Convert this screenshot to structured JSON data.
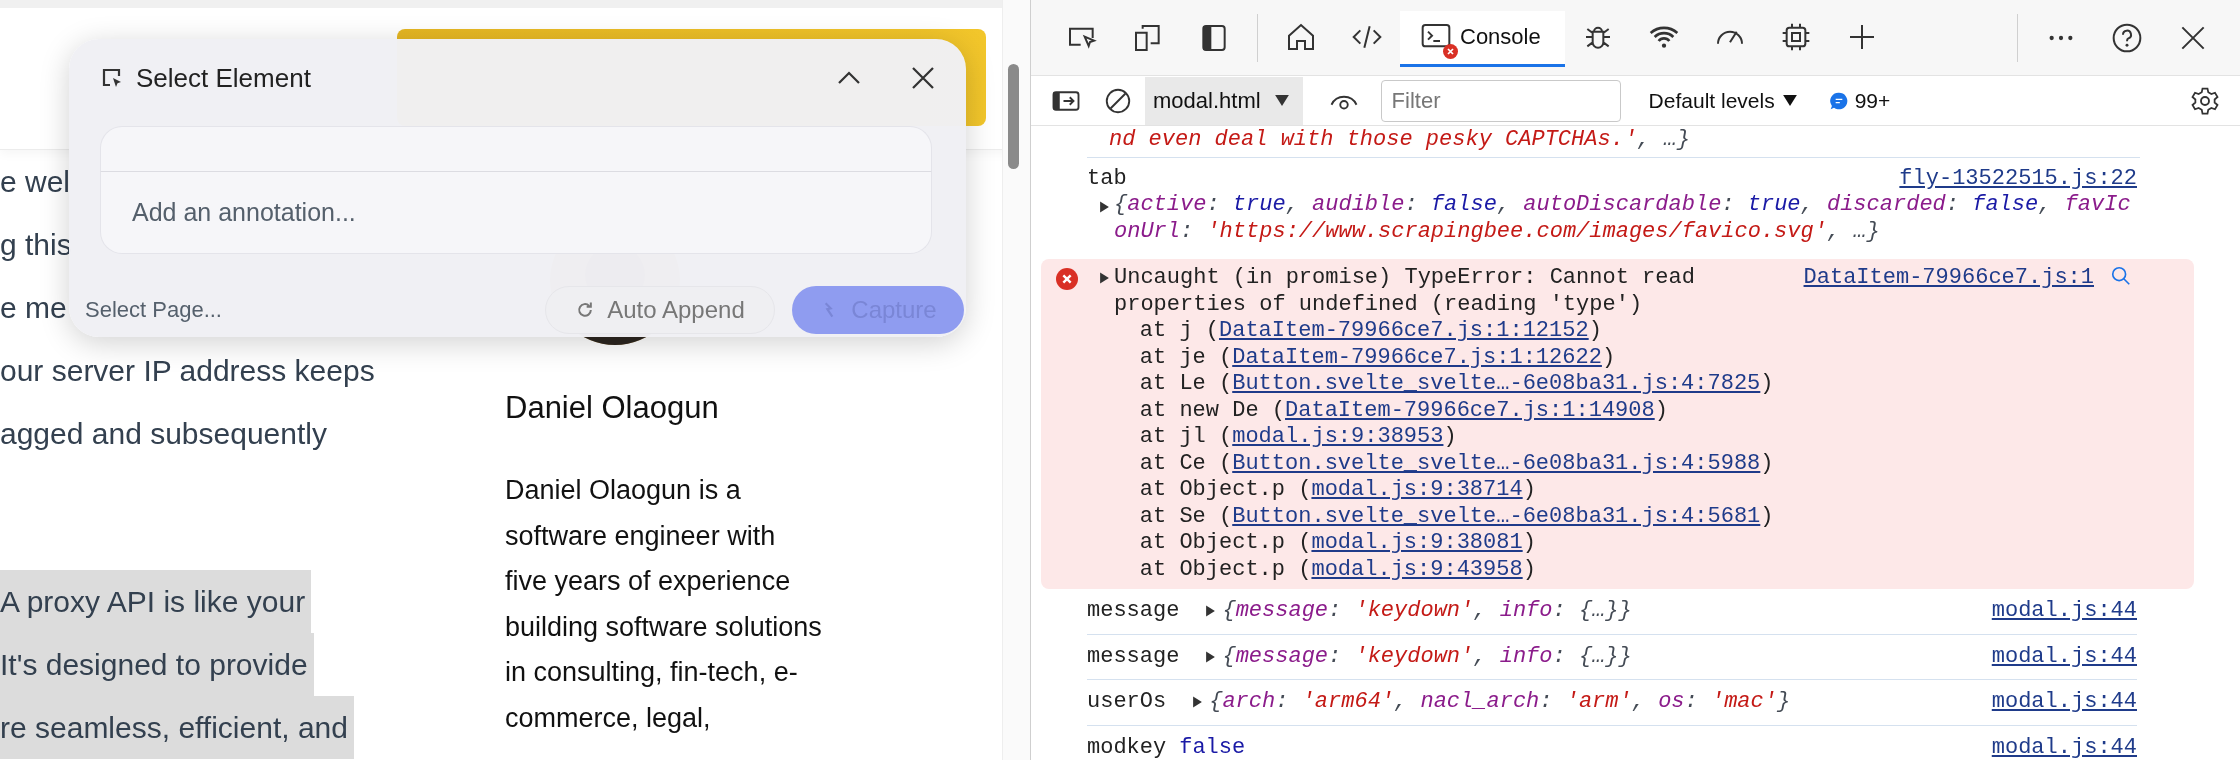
{
  "page": {
    "article_paragraphs": [
      {
        "highlighted": false,
        "lines": [
          "e wel",
          "g this",
          "e me",
          "our server IP address keeps",
          "agged and subsequently"
        ]
      },
      {
        "highlighted": true,
        "lines": [
          "A proxy API is like your",
          "It's designed to provide",
          "re seamless, efficient, and"
        ]
      }
    ],
    "author": {
      "name": "Daniel Olaogun",
      "bio_lines": [
        "Daniel Olaogun is a",
        "software engineer with",
        "five years of experience",
        "building software solutions",
        "in consulting, fin-tech, e-",
        "commerce, legal,"
      ]
    }
  },
  "select_panel": {
    "title": "Select Element",
    "annotation": {
      "placeholder": "Add an annotation..."
    },
    "page_select": {
      "placeholder": "Select Page..."
    },
    "auto_append": {
      "label": "Auto Append"
    },
    "capture": {
      "label": "Capture",
      "disabled": true
    }
  },
  "devtools": {
    "left_buttons": [
      {
        "kind": "inspect"
      },
      {
        "kind": "device"
      },
      {
        "kind": "sidebar"
      }
    ],
    "tabs": [
      {
        "kind": "home",
        "selected": false,
        "error_badge": false
      },
      {
        "kind": "code",
        "selected": false,
        "error_badge": false
      },
      {
        "kind": "console",
        "label": "Console",
        "selected": true,
        "error_badge": true
      },
      {
        "kind": "bug",
        "selected": false,
        "error_badge": false
      },
      {
        "kind": "wifi",
        "selected": false,
        "error_badge": false
      },
      {
        "kind": "gauge",
        "selected": false,
        "error_badge": false
      },
      {
        "kind": "chip",
        "selected": false,
        "error_badge": false
      },
      {
        "kind": "plus",
        "selected": false,
        "error_badge": false
      }
    ],
    "right_buttons": [
      {
        "kind": "more"
      },
      {
        "kind": "help"
      },
      {
        "kind": "close"
      }
    ],
    "console_toolbar": {
      "context": "modal.html",
      "filter": {
        "placeholder": "Filter"
      },
      "levels": "Default levels",
      "message_count": "99+"
    },
    "entries": [
      {
        "kind": "continuation",
        "tokens": [
          {
            "kind": "str",
            "text": "nd even deal with those pesky CAPTCHAs.'"
          },
          {
            "kind": "punct",
            "text": ", …}"
          }
        ]
      },
      {
        "kind": "log",
        "label": "tab",
        "source": "fly-13522515.js:22",
        "expandable": true,
        "wrapped": true,
        "tokens": [
          {
            "kind": "punct",
            "text": "{"
          },
          {
            "kind": "key",
            "text": "active"
          },
          {
            "kind": "punct",
            "text": ": "
          },
          {
            "kind": "lit",
            "text": "true"
          },
          {
            "kind": "punct",
            "text": ", "
          },
          {
            "kind": "key",
            "text": "audible"
          },
          {
            "kind": "punct",
            "text": ": "
          },
          {
            "kind": "lit",
            "text": "false"
          },
          {
            "kind": "punct",
            "text": ", "
          },
          {
            "kind": "key",
            "text": "autoDiscardable"
          },
          {
            "kind": "punct",
            "text": ": "
          },
          {
            "kind": "lit",
            "text": "true"
          },
          {
            "kind": "punct",
            "text": ", "
          },
          {
            "kind": "key",
            "text": "discarded"
          },
          {
            "kind": "punct",
            "text": ": "
          },
          {
            "kind": "lit",
            "text": "false"
          },
          {
            "kind": "punct",
            "text": ", "
          },
          {
            "kind": "key",
            "text": "favIconUrl"
          },
          {
            "kind": "punct",
            "text": ": "
          },
          {
            "kind": "str",
            "text": "'https://www.scrapingbee.com/images/favico.svg'"
          },
          {
            "kind": "punct",
            "text": ", …}"
          }
        ]
      },
      {
        "kind": "error",
        "message": "Uncaught (in promise) TypeError: Cannot read properties of undefined (reading 'type')",
        "source": "DataItem-79966ce7.js:1",
        "stack": [
          {
            "prefix": "at j (",
            "link": "DataItem-79966ce7.js:1:12152",
            "suffix": ")"
          },
          {
            "prefix": "at je (",
            "link": "DataItem-79966ce7.js:1:12622",
            "suffix": ")"
          },
          {
            "prefix": "at Le (",
            "link": "Button.svelte_svelte…-6e08ba31.js:4:7825",
            "suffix": ")"
          },
          {
            "prefix": "at new De (",
            "link": "DataItem-79966ce7.js:1:14908",
            "suffix": ")"
          },
          {
            "prefix": "at jl (",
            "link": "modal.js:9:38953",
            "suffix": ")"
          },
          {
            "prefix": "at Ce (",
            "link": "Button.svelte_svelte…-6e08ba31.js:4:5988",
            "suffix": ")"
          },
          {
            "prefix": "at Object.p (",
            "link": "modal.js:9:38714",
            "suffix": ")"
          },
          {
            "prefix": "at Se (",
            "link": "Button.svelte_svelte…-6e08ba31.js:4:5681",
            "suffix": ")"
          },
          {
            "prefix": "at Object.p (",
            "link": "modal.js:9:38081",
            "suffix": ")"
          },
          {
            "prefix": "at Object.p (",
            "link": "modal.js:9:43958",
            "suffix": ")"
          }
        ]
      },
      {
        "kind": "log",
        "label": "message",
        "source": "modal.js:44",
        "expandable": true,
        "wrapped": false,
        "tokens": [
          {
            "kind": "punct",
            "text": "{"
          },
          {
            "kind": "key",
            "text": "message"
          },
          {
            "kind": "punct",
            "text": ": "
          },
          {
            "kind": "str",
            "text": "'keydown'"
          },
          {
            "kind": "punct",
            "text": ", "
          },
          {
            "kind": "key",
            "text": "info"
          },
          {
            "kind": "punct",
            "text": ": {…}}"
          }
        ]
      },
      {
        "kind": "log",
        "label": "message",
        "source": "modal.js:44",
        "expandable": true,
        "wrapped": false,
        "tokens": [
          {
            "kind": "punct",
            "text": "{"
          },
          {
            "kind": "key",
            "text": "message"
          },
          {
            "kind": "punct",
            "text": ": "
          },
          {
            "kind": "str",
            "text": "'keydown'"
          },
          {
            "kind": "punct",
            "text": ", "
          },
          {
            "kind": "key",
            "text": "info"
          },
          {
            "kind": "punct",
            "text": ": {…}}"
          }
        ]
      },
      {
        "kind": "log",
        "label": "userOs",
        "source": "modal.js:44",
        "expandable": true,
        "wrapped": false,
        "tokens": [
          {
            "kind": "punct",
            "text": "{"
          },
          {
            "kind": "key",
            "text": "arch"
          },
          {
            "kind": "punct",
            "text": ": "
          },
          {
            "kind": "str",
            "text": "'arm64'"
          },
          {
            "kind": "punct",
            "text": ", "
          },
          {
            "kind": "key",
            "text": "nacl_arch"
          },
          {
            "kind": "punct",
            "text": ": "
          },
          {
            "kind": "str",
            "text": "'arm'"
          },
          {
            "kind": "punct",
            "text": ", "
          },
          {
            "kind": "key",
            "text": "os"
          },
          {
            "kind": "punct",
            "text": ": "
          },
          {
            "kind": "str",
            "text": "'mac'"
          },
          {
            "kind": "punct",
            "text": "}"
          }
        ]
      },
      {
        "kind": "log",
        "label": "modkey",
        "source": "modal.js:44",
        "expandable": false,
        "wrapped": false,
        "tokens": [
          {
            "kind": "lit",
            "text": "false"
          }
        ]
      }
    ]
  }
}
